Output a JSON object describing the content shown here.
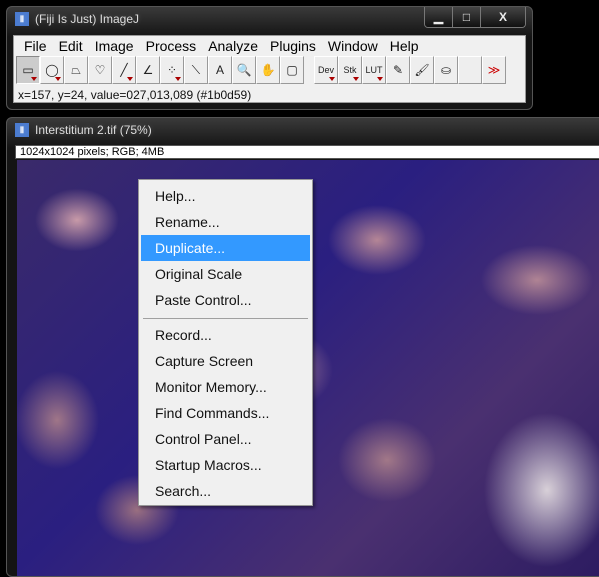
{
  "main_window": {
    "title": "(Fiji Is Just) ImageJ",
    "controls": [
      "▁",
      "□",
      "X"
    ],
    "menu": [
      "File",
      "Edit",
      "Image",
      "Process",
      "Analyze",
      "Plugins",
      "Window",
      "Help"
    ],
    "tools": [
      {
        "name": "rectangle-tool",
        "glyph": "▭",
        "sel": true,
        "tri": true
      },
      {
        "name": "oval-tool",
        "glyph": "◯",
        "tri": true
      },
      {
        "name": "polygon-tool",
        "glyph": "⏢"
      },
      {
        "name": "freehand-tool",
        "glyph": "♡"
      },
      {
        "name": "line-tool",
        "glyph": "╱",
        "tri": true
      },
      {
        "name": "angle-tool",
        "glyph": "∠"
      },
      {
        "name": "point-tool",
        "glyph": "⁘",
        "tri": true
      },
      {
        "name": "wand-tool",
        "glyph": "⟍"
      },
      {
        "name": "text-tool",
        "glyph": "A"
      },
      {
        "name": "magnifier-tool",
        "glyph": "🔍"
      },
      {
        "name": "hand-tool",
        "glyph": "✋"
      },
      {
        "name": "dropper-tool",
        "glyph": "▢"
      },
      {
        "gap": true
      },
      {
        "name": "dev-menu",
        "glyph": "Dev",
        "tri": true
      },
      {
        "name": "stk-menu",
        "glyph": "Stk",
        "tri": true
      },
      {
        "name": "lut-menu",
        "glyph": "LUT",
        "tri": true
      },
      {
        "name": "pencil-tool",
        "glyph": "✎"
      },
      {
        "name": "brush-tool",
        "glyph": "🖌"
      },
      {
        "name": "flood-fill-tool",
        "glyph": "⛀"
      },
      {
        "name": "blank-tool",
        "glyph": ""
      },
      {
        "name": "more-tools",
        "glyph": "≫",
        "color": "#c00"
      }
    ],
    "status": "x=157, y=24, value=027,013,089 (#1b0d59)"
  },
  "image_window": {
    "title": "Interstitium 2.tif (75%)",
    "info": "1024x1024 pixels; RGB; 4MB"
  },
  "context_menu": {
    "items": [
      "Help...",
      "Rename...",
      "Duplicate...",
      "Original Scale",
      "Paste Control..."
    ],
    "items2": [
      "Record...",
      "Capture Screen",
      "Monitor Memory...",
      "Find Commands...",
      "Control Panel...",
      "Startup Macros...",
      "Search..."
    ],
    "highlighted": "Duplicate...",
    "highlight_color": "#3399ff"
  }
}
